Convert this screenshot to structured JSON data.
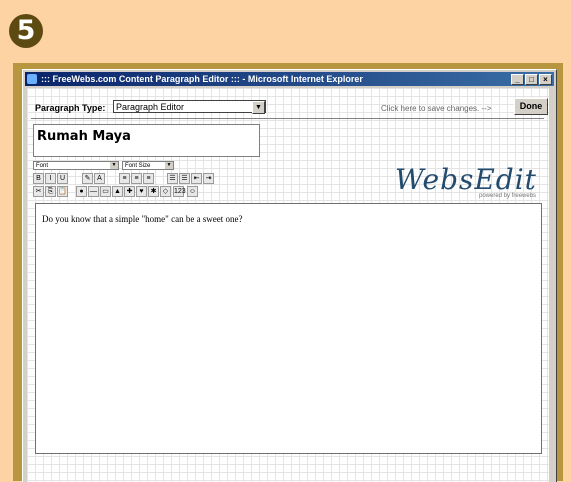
{
  "step_number": "5",
  "window": {
    "title": "::: FreeWebs.com Content Paragraph Editor ::: - Microsoft Internet Explorer",
    "controls": {
      "minimize": "_",
      "maximize": "□",
      "close": "×"
    }
  },
  "toolbar_top": {
    "paragraph_type_label": "Paragraph Type:",
    "paragraph_type_value": "Paragraph Editor",
    "save_hint": "Click here to save changes. -->",
    "done_label": "Done"
  },
  "paragraph_title": "Rumah Maya",
  "format": {
    "font_placeholder": "Font",
    "font_size_placeholder": "Font Size",
    "buttons_row1": [
      {
        "name": "bold-button",
        "glyph": "B"
      },
      {
        "name": "italic-button",
        "glyph": "I"
      },
      {
        "name": "underline-button",
        "glyph": "U"
      },
      {
        "name": "highlight-button",
        "glyph": "✎"
      },
      {
        "name": "text-color-button",
        "glyph": "A"
      },
      {
        "name": "align-left-button",
        "glyph": "≡"
      },
      {
        "name": "align-center-button",
        "glyph": "≡"
      },
      {
        "name": "align-right-button",
        "glyph": "≡"
      },
      {
        "name": "ordered-list-button",
        "glyph": "☰"
      },
      {
        "name": "unordered-list-button",
        "glyph": "☰"
      },
      {
        "name": "outdent-button",
        "glyph": "⇤"
      },
      {
        "name": "indent-button",
        "glyph": "⇥"
      }
    ],
    "buttons_row2": [
      {
        "name": "cut-button",
        "glyph": "✂"
      },
      {
        "name": "copy-button",
        "glyph": "⎘"
      },
      {
        "name": "paste-button",
        "glyph": "📋"
      },
      {
        "name": "link-button",
        "glyph": "●"
      },
      {
        "name": "horizontal-rule-button",
        "glyph": "—"
      },
      {
        "name": "table-button",
        "glyph": "▭"
      },
      {
        "name": "image-button",
        "glyph": "▲"
      },
      {
        "name": "insert-picture-button",
        "glyph": "✚"
      },
      {
        "name": "flash-button",
        "glyph": "♥"
      },
      {
        "name": "special-char-button",
        "glyph": "✱"
      },
      {
        "name": "form-button",
        "glyph": "◇"
      },
      {
        "name": "counter-button",
        "glyph": "123"
      },
      {
        "name": "smiley-button",
        "glyph": "☺"
      }
    ]
  },
  "logo": {
    "text": "WebsEdit",
    "tagline": "powered by freewebs"
  },
  "editor_content": "Do you know that a simple \"home\" can be a sweet one?",
  "colors": {
    "page_bg": "#fdd3a3",
    "frame": "#b8963f",
    "titlebar": "#0a246a",
    "badge": "#5d4a10"
  }
}
